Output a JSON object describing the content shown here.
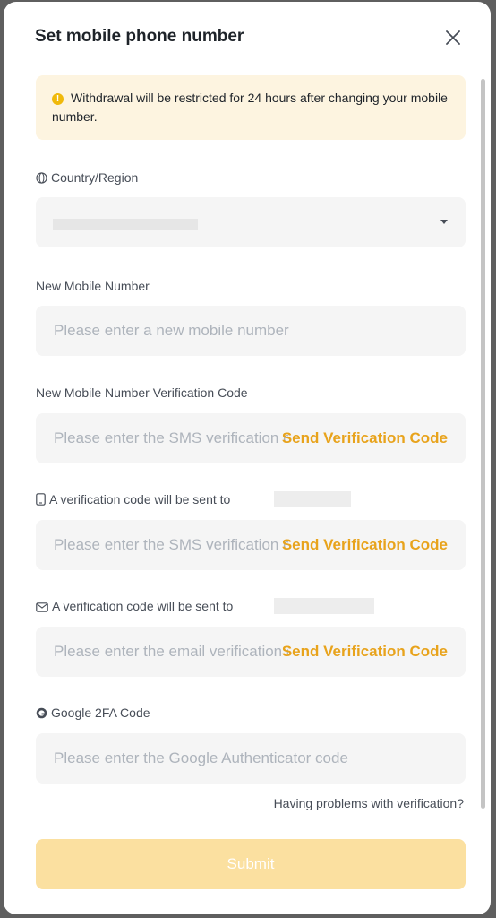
{
  "dialog": {
    "title": "Set mobile phone number",
    "close_icon": "close-icon"
  },
  "warning": {
    "icon": "warning-icon",
    "text": "Withdrawal will be restricted for 24 hours after changing your mobile number."
  },
  "country": {
    "label": "Country/Region",
    "icon": "globe-icon",
    "value_redacted": true,
    "dropdown_icon": "caret-down-icon"
  },
  "new_mobile": {
    "label": "New Mobile Number",
    "placeholder": "Please enter a new mobile number"
  },
  "new_mobile_code": {
    "label": "New Mobile Number Verification Code",
    "placeholder": "Please enter the SMS verification code",
    "send_label": "Send Verification Code"
  },
  "old_mobile_code": {
    "label": "A verification code will be sent to",
    "icon": "phone-icon",
    "placeholder": "Please enter the SMS verification code",
    "send_label": "Send Verification Code"
  },
  "email_code": {
    "label": "A verification code will be sent to",
    "icon": "mail-icon",
    "placeholder": "Please enter the email verification code",
    "send_label": "Send Verification Code"
  },
  "google_2fa": {
    "label": "Google 2FA Code",
    "icon": "google-auth-icon",
    "placeholder": "Please enter the Google Authenticator code"
  },
  "help_link": "Having problems with verification?",
  "submit_label": "Submit",
  "colors": {
    "accent": "#e8a31c",
    "warning_bg": "#fdf4e0",
    "submit_disabled": "#fbe0a0",
    "field_bg": "#f5f5f5"
  }
}
